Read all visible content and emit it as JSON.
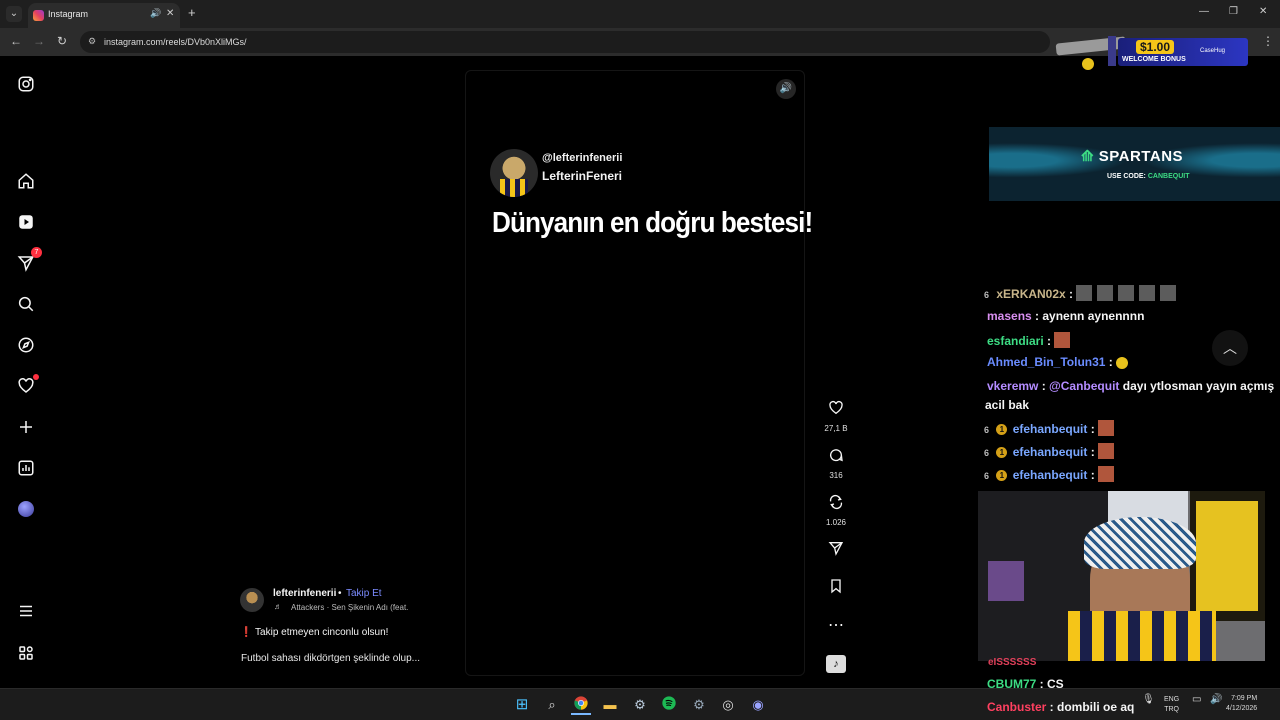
{
  "browser": {
    "tab_title": "Instagram",
    "audio_icon": "🔊",
    "close_icon": "✕",
    "new_tab": "+",
    "url": "instagram.com/reels/DVb0nXliMGs/",
    "window_controls": [
      "—",
      "❐",
      "✕"
    ],
    "menu": "⋮"
  },
  "ad_bonus": {
    "amount": "$1.00",
    "text": "WELCOME BONUS",
    "brand": "CaseHug"
  },
  "nav": {
    "messages_badge": "7"
  },
  "reel": {
    "handle": "@lefterinfenerii",
    "name": "LefterinFeneri",
    "headline": "Dünyanın en doğru bestesi!",
    "mute_icon": "🔊"
  },
  "actions": {
    "likes": "27,1 B",
    "comments": "316",
    "reposts": "1.026"
  },
  "caption": {
    "author": "lefterinfenerii",
    "separator": "•",
    "follow": "Takip Et",
    "music": "Attackers · Sen Şikenin Adı (feat.",
    "line1": "❗ Takip etmeyen cinconlu olsun!",
    "line2": "Futbol sahası dikdörtgen şeklinde olup..."
  },
  "spartans": {
    "logo": "SPARTANS",
    "code_label": "USE CODE:",
    "code": "CANBEQUIT"
  },
  "chat": [
    {
      "user": "xERKAN02x",
      "user_color": "#c8b58a",
      "text": "",
      "badge": "6"
    },
    {
      "user": "masens",
      "user_color": "#d98ff0",
      "text": "aynenn aynennnn"
    },
    {
      "user": "esfandiari",
      "user_color": "#3ddc84",
      "text": ""
    },
    {
      "user": "Ahmed_Bin_Tolun31",
      "user_color": "#6a8cff",
      "text": ""
    },
    {
      "user": "vkeremw",
      "user_color": "#b48cff",
      "mention": "@Canbequit",
      "text": "dayı ytlosman yayın açmış",
      "wrap": "acil bak"
    },
    {
      "user": "efehanbequit",
      "user_color": "#7aa7ff",
      "badge": "6",
      "badge2": "1",
      "text": ""
    },
    {
      "user": "efehanbequit",
      "user_color": "#7aa7ff",
      "badge": "6",
      "badge2": "1",
      "text": ""
    },
    {
      "user": "efehanbequit",
      "user_color": "#7aa7ff",
      "badge": "6",
      "badge2": "1",
      "text": ""
    }
  ],
  "chat_bottom": [
    {
      "user": "eISSSSSS",
      "user_color": "#e0405a",
      "text": ""
    },
    {
      "user": "CBUM77",
      "user_color": "#3ddc84",
      "text": "CS"
    },
    {
      "user": "Canbuster",
      "user_color": "#ff4060",
      "text": "dombili oe aq"
    }
  ],
  "tray": {
    "lang1": "ENG",
    "lang2": "TRQ",
    "time": "7:09 PM",
    "date": "4/12/2026"
  },
  "icons": {
    "instagram": "instagram-icon",
    "home": "home-icon",
    "reels": "reels-icon",
    "messages": "send-icon",
    "search": "search-icon",
    "explore": "compass-icon",
    "notifications": "heart-icon",
    "create": "plus-icon",
    "dashboard": "chart-icon",
    "profile": "avatar-icon",
    "more": "menu-icon",
    "threads": "threads-icon"
  }
}
